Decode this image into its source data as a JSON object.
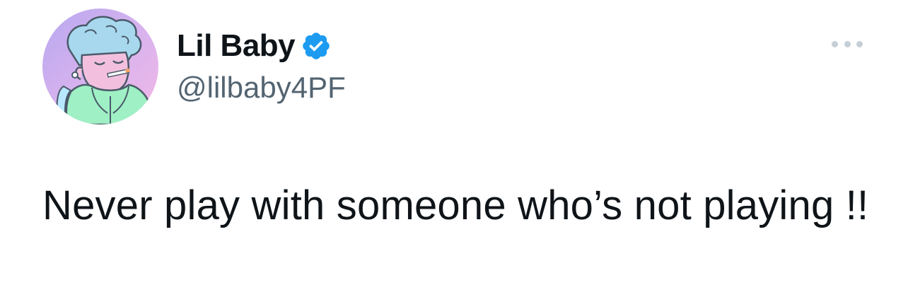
{
  "author": {
    "display_name": "Lil Baby",
    "handle": "@lilbaby4PF",
    "verified": true,
    "verified_color": "#1d9bf0"
  },
  "tweet": {
    "text": "Never play with someone who’s not playing !!"
  },
  "icons": {
    "more": "more-horizontal-icon",
    "verified": "verified-badge-icon"
  }
}
